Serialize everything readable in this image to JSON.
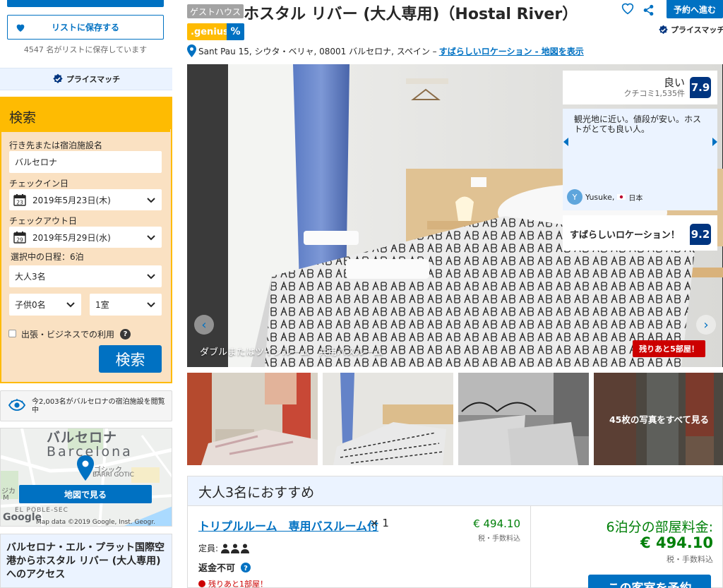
{
  "sidebar": {
    "save_list_label": "リストに保存する",
    "saved_count_text": "4547 名がリストに保存しています",
    "price_match_label": "プライスマッチ",
    "search": {
      "title": "検索",
      "destination_label": "行き先または宿泊施設名",
      "destination_value": "バルセロナ",
      "checkin_label": "チェックイン日",
      "checkin_day": "23",
      "checkin_value": "2019年5月23日(木)",
      "checkout_label": "チェックアウト日",
      "checkout_day": "29",
      "checkout_value": "2019年5月29日(水)",
      "nights_text": "選択中の日程：6泊",
      "adults_value": "大人3名",
      "children_value": "子供0名",
      "rooms_value": "1室",
      "business_label": "出張・ビジネスでの利用",
      "help_glyph": "?",
      "search_button": "検索"
    },
    "viewers_text": "今2,003名がバルセロナの宿泊施設を閲覧中",
    "map": {
      "city_jp": "バルセロナ",
      "city_en": "Barcelona",
      "district_jp": "ゴシック",
      "district_en": "BARRI GOTIC",
      "district2": "EL POBLE-SEC",
      "side_label": "ジカ",
      "side_label2": "M",
      "view_map_button": "地図で見る",
      "google": "Google",
      "attribution": "Map data ©2019 Google, Inst. Geogr. Nacional"
    },
    "access_text": "バルセロナ・エル・プラット国際空港からホスタル リバー (大人専用)へのアクセス"
  },
  "header": {
    "badge": "ゲストハウス",
    "title": "ホスタル リバー (大人専用)（Hostal River）",
    "genius": ".genius",
    "genius_pct": "%",
    "address": "Sant Pau 15, シウタ・ベリャ, 08001 バルセロナ, スペイン –",
    "location_link": "すばらしいロケーション - 地図を表示",
    "reserve_button": "予約へ進む",
    "price_match": "プライスマッチ"
  },
  "gallery": {
    "caption": "ダブルまたはツインルーム　共用バスルーム",
    "rooms_left": "残りあと5部屋！",
    "see_all": "45枚の写真をすべて見る",
    "prev_glyph": "‹",
    "next_glyph": "›"
  },
  "review": {
    "word": "良い",
    "count": "クチコミ1,535件",
    "score": "7.9",
    "quote": "観光地に近い。値段が安い。ホストがとても良い人。",
    "avatar_letter": "Y",
    "user": "Yusuke,",
    "country": "日本",
    "location_label": "すばらしいロケーション！",
    "location_score": "9.2"
  },
  "recommend": {
    "heading": "大人3名におすすめ",
    "room_name": "トリプルルーム　専用バスルーム付",
    "room_qty": "× 1",
    "room_price": "€ 494.10",
    "room_tax": "税・手数料込",
    "capacity_label": "定員:",
    "nonrefundable": "返金不可",
    "last_room": "残りあと1部屋！",
    "nights_label": "6泊分の部屋料金:",
    "total_price": "€ 494.10",
    "total_tax": "税・手数料込",
    "book_button": "この客室を予約"
  },
  "colors": {
    "brand_blue": "#0071c2",
    "dark_blue": "#003580",
    "yellow": "#febb02",
    "green": "#008009",
    "red": "#cc0000"
  }
}
